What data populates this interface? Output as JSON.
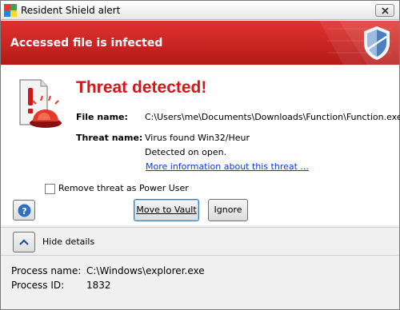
{
  "window": {
    "title": "Resident Shield alert"
  },
  "banner": {
    "title": "Accessed file is infected"
  },
  "alert": {
    "heading": "Threat detected!",
    "file_name_label": "File name:",
    "file_name_value": "C:\\Users\\me\\Documents\\Downloads\\Function\\Function.exe",
    "threat_name_label": "Threat name:",
    "threat_name_value": "Virus found Win32/Heur",
    "detected_text": "Detected on open.",
    "more_info_link": "More information about this threat ..."
  },
  "options": {
    "remove_as_power_user": "Remove threat as Power User",
    "remove_checked": false
  },
  "buttons": {
    "move_to_vault": "Move to Vault",
    "ignore": "Ignore"
  },
  "details": {
    "toggle_label": "Hide details",
    "process_name_label": "Process name:",
    "process_name_value": "C:\\Windows\\explorer.exe",
    "process_id_label": "Process ID:",
    "process_id_value": "1832"
  },
  "icons": {
    "app": "resident-shield-app-icon",
    "close": "close-icon",
    "shield": "shield-logo-icon",
    "alarm": "alarm-siren-icon",
    "help": "help-icon",
    "collapse": "chevron-up-icon"
  },
  "colors": {
    "banner_red": "#c8201e",
    "heading_red": "#d7141a",
    "link_blue": "#0a3ccf"
  }
}
